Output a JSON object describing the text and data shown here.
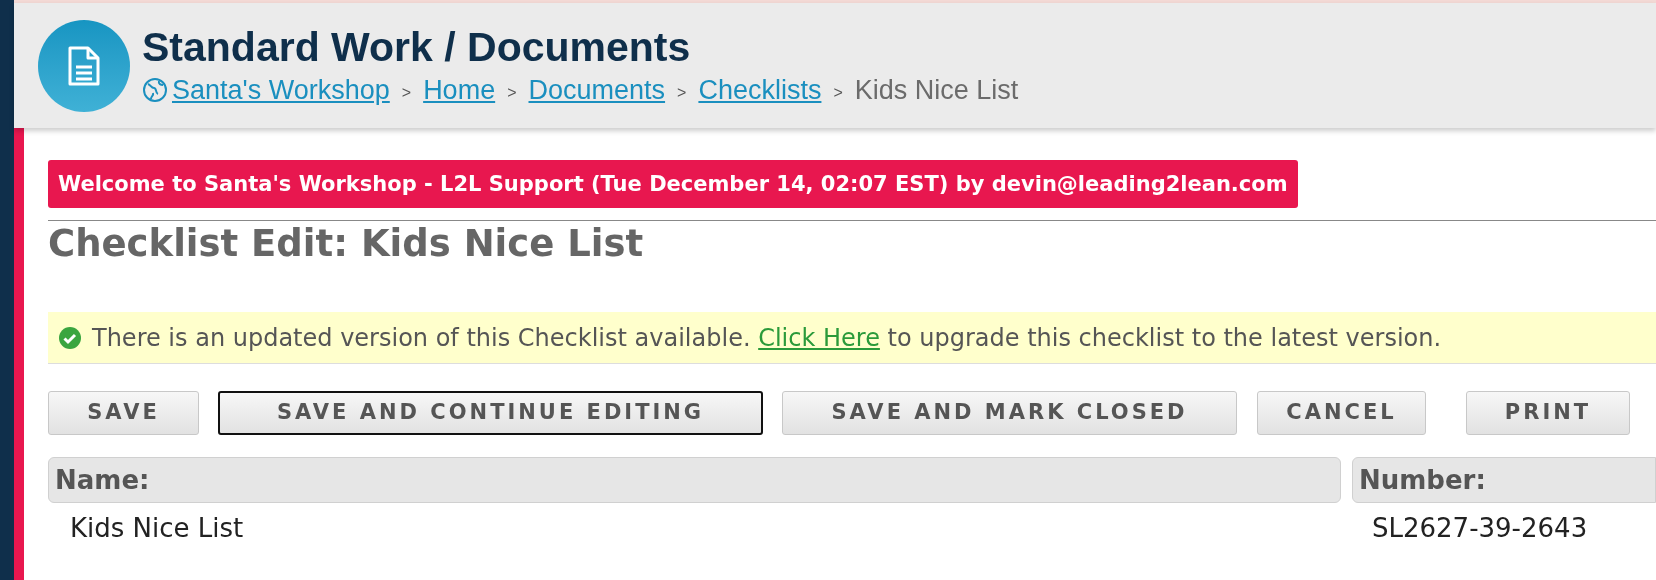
{
  "header": {
    "title": "Standard Work / Documents",
    "breadcrumbs": [
      {
        "label": "Santa's Workshop",
        "kind": "link"
      },
      {
        "label": "Home",
        "kind": "link"
      },
      {
        "label": "Documents",
        "kind": "link"
      },
      {
        "label": "Checklists",
        "kind": "link"
      },
      {
        "label": "Kids Nice List",
        "kind": "current"
      }
    ],
    "separator": ">"
  },
  "welcome_banner": "Welcome to Santa's Workshop - L2L Support (Tue December 14, 02:07 EST) by devin@leading2lean.com",
  "page_title": "Checklist Edit: Kids Nice List",
  "notice": {
    "before": "There is an updated version of this Checklist available.",
    "link": "Click Here",
    "after": "to upgrade this checklist to the latest version."
  },
  "buttons": [
    {
      "label": "SAVE",
      "focused": false
    },
    {
      "label": "SAVE AND CONTINUE EDITING",
      "focused": true
    },
    {
      "label": "SAVE AND MARK CLOSED",
      "focused": false
    },
    {
      "label": "CANCEL",
      "focused": false
    },
    {
      "label": "PRINT",
      "focused": false
    }
  ],
  "fields": [
    {
      "label": "Name:",
      "value": "Kids Nice List"
    },
    {
      "label": "Number:",
      "value": "SL2627-39-2643"
    }
  ]
}
